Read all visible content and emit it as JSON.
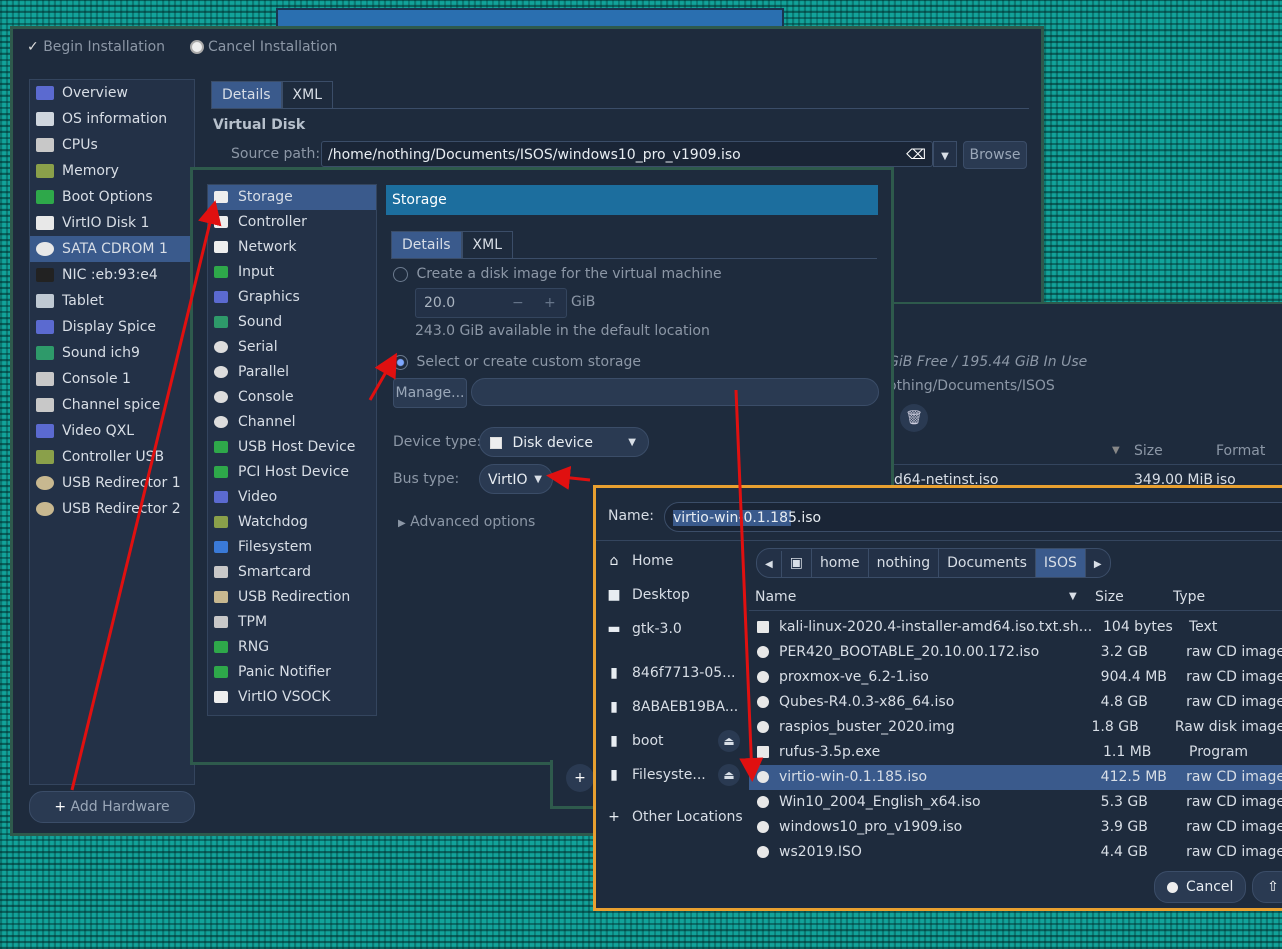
{
  "main_window": {
    "begin_label": "Begin Installation",
    "cancel_label": "Cancel Installation",
    "nav_items": [
      {
        "label": "Overview",
        "icon": "monitor-icon"
      },
      {
        "label": "OS information",
        "icon": "info-icon"
      },
      {
        "label": "CPUs",
        "icon": "cpu-icon"
      },
      {
        "label": "Memory",
        "icon": "memory-icon"
      },
      {
        "label": "Boot Options",
        "icon": "boot-icon"
      },
      {
        "label": "VirtIO Disk 1",
        "icon": "disk-icon"
      },
      {
        "label": "SATA CDROM 1",
        "icon": "cdrom-icon"
      },
      {
        "label": "NIC :eb:93:e4",
        "icon": "nic-icon"
      },
      {
        "label": "Tablet",
        "icon": "tablet-icon"
      },
      {
        "label": "Display Spice",
        "icon": "display-icon"
      },
      {
        "label": "Sound ich9",
        "icon": "sound-icon"
      },
      {
        "label": "Console 1",
        "icon": "console-icon"
      },
      {
        "label": "Channel spice",
        "icon": "channel-icon"
      },
      {
        "label": "Video QXL",
        "icon": "video-icon"
      },
      {
        "label": "Controller USB",
        "icon": "controller-icon"
      },
      {
        "label": "USB Redirector 1",
        "icon": "usb-icon"
      },
      {
        "label": "USB Redirector 2",
        "icon": "usb-icon"
      }
    ],
    "add_hardware": "Add Hardware",
    "tabs": [
      "Details",
      "XML"
    ],
    "section_title": "Virtual Disk",
    "source_label": "Source path:",
    "source_value": "/home/nothing/Documents/ISOS/windows10_pro_v1909.iso",
    "browse": "Browse"
  },
  "add_hw_dialog": {
    "types": [
      "Storage",
      "Controller",
      "Network",
      "Input",
      "Graphics",
      "Sound",
      "Serial",
      "Parallel",
      "Console",
      "Channel",
      "USB Host Device",
      "PCI Host Device",
      "Video",
      "Watchdog",
      "Filesystem",
      "Smartcard",
      "USB Redirection",
      "TPM",
      "RNG",
      "Panic Notifier",
      "VirtIO VSOCK"
    ],
    "header": "Storage",
    "tabs": [
      "Details",
      "XML"
    ],
    "create_label": "Create a disk image for the virtual machine",
    "size_value": "20.0",
    "size_unit": "GiB",
    "available": "243.0 GiB available in the default location",
    "custom_label": "Select or create custom storage",
    "manage": "Manage...",
    "device_type_label": "Device type:",
    "device_type_value": "Disk device",
    "bus_type_label": "Bus type:",
    "bus_type_value": "VirtIO",
    "advanced": "Advanced options"
  },
  "pool_window": {
    "free_text": "GiB Free / 195.44 GiB In Use",
    "path_text": "othing/Documents/ISOS",
    "col_size": "Size",
    "col_format": "Format",
    "row_name": "d64-netinst.iso",
    "row_size": "349.00 MiB",
    "row_format": "iso"
  },
  "file_chooser": {
    "name_label": "Name:",
    "name_value": "virtio-win-0.1.185.iso",
    "places": [
      {
        "label": "Home",
        "icon": "home-icon"
      },
      {
        "label": "Desktop",
        "icon": "desktop-icon"
      },
      {
        "label": "gtk-3.0",
        "icon": "folder-icon"
      },
      {
        "label": "846f7713-05...",
        "icon": "drive-icon"
      },
      {
        "label": "8ABAEB19BA...",
        "icon": "drive-icon"
      },
      {
        "label": "boot",
        "icon": "drive-icon"
      },
      {
        "label": "Filesyste...",
        "icon": "drive-icon"
      },
      {
        "label": "Other Locations",
        "icon": "plus-icon"
      }
    ],
    "breadcrumb": [
      "home",
      "nothing",
      "Documents",
      "ISOS"
    ],
    "col_name": "Name",
    "col_size": "Size",
    "col_type": "Type",
    "files": [
      {
        "name": "kali-linux-2020.4-installer-amd64.iso.txt.sh...",
        "size": "104 bytes",
        "type": "Text"
      },
      {
        "name": "PER420_BOOTABLE_20.10.00.172.iso",
        "size": "3.2 GB",
        "type": "raw CD image"
      },
      {
        "name": "proxmox-ve_6.2-1.iso",
        "size": "904.4 MB",
        "type": "raw CD image"
      },
      {
        "name": "Qubes-R4.0.3-x86_64.iso",
        "size": "4.8 GB",
        "type": "raw CD image"
      },
      {
        "name": "raspios_buster_2020.img",
        "size": "1.8 GB",
        "type": "Raw disk image"
      },
      {
        "name": "rufus-3.5p.exe",
        "size": "1.1 MB",
        "type": "Program"
      },
      {
        "name": "virtio-win-0.1.185.iso",
        "size": "412.5 MB",
        "type": "raw CD image"
      },
      {
        "name": "Win10_2004_English_x64.iso",
        "size": "5.3 GB",
        "type": "raw CD image"
      },
      {
        "name": "windows10_pro_v1909.iso",
        "size": "3.9 GB",
        "type": "raw CD image"
      },
      {
        "name": "ws2019.ISO",
        "size": "4.4 GB",
        "type": "raw CD image"
      }
    ],
    "cancel": "Cancel"
  }
}
